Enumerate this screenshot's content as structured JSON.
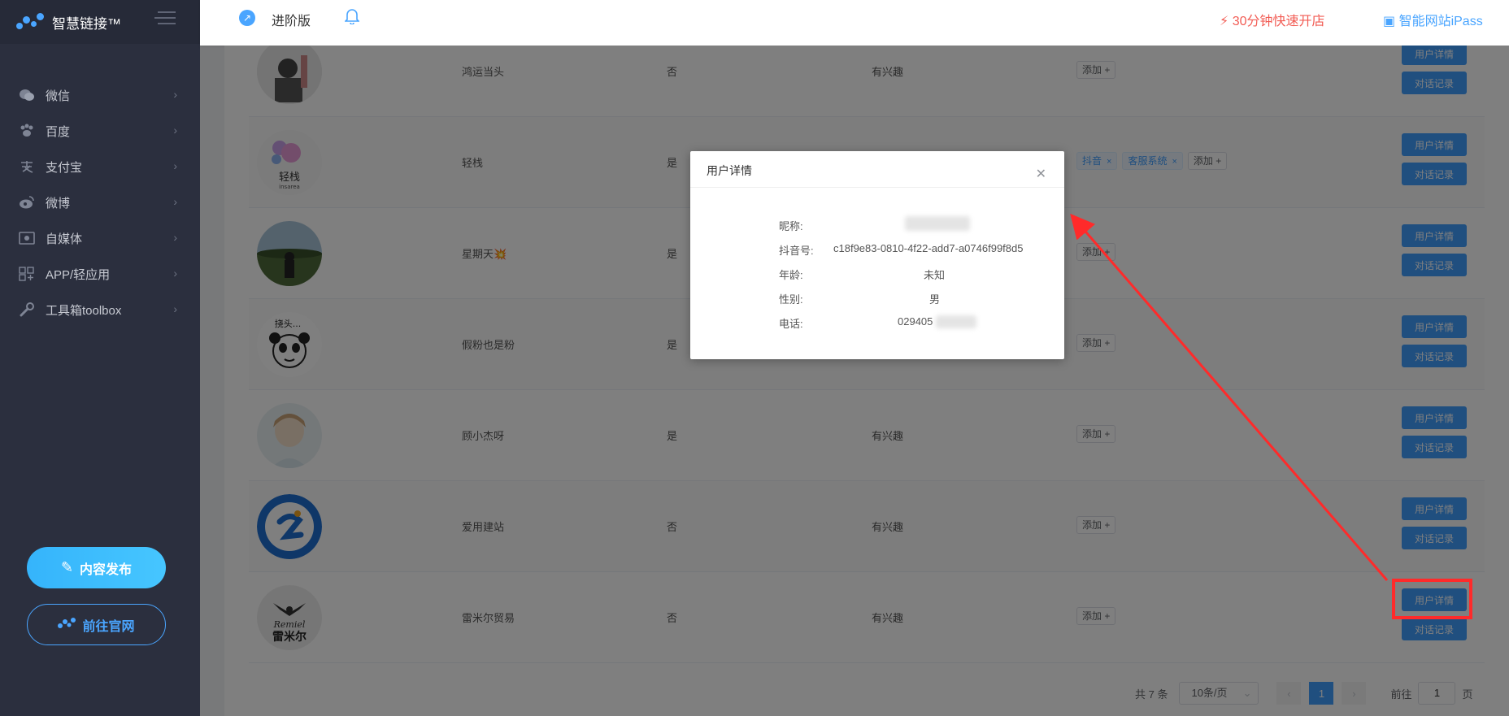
{
  "sidebar": {
    "brand": "智慧链接™",
    "items": [
      {
        "label": "微信",
        "icon": "wechat-icon"
      },
      {
        "label": "百度",
        "icon": "paw-icon"
      },
      {
        "label": "支付宝",
        "icon": "alipay-icon"
      },
      {
        "label": "微博",
        "icon": "weibo-icon"
      },
      {
        "label": "自媒体",
        "icon": "media-icon"
      },
      {
        "label": "APP/轻应用",
        "icon": "apps-icon"
      },
      {
        "label": "工具箱toolbox",
        "icon": "wrench-icon"
      }
    ],
    "publish_label": "内容发布",
    "site_label": "前往官网"
  },
  "header": {
    "edition": "进阶版",
    "quick_open": "30分钟快速开店",
    "ipass": "智能网站iPass"
  },
  "table": {
    "add_label": "添加 +",
    "detail_label": "用户详情",
    "chat_label": "对话记录",
    "rows": [
      {
        "name": "鸿运当头",
        "follow": "否",
        "interest": "有兴趣",
        "tags": []
      },
      {
        "name": "轻栈",
        "follow": "是",
        "interest": "",
        "tags": [
          "抖音",
          "客服系统"
        ]
      },
      {
        "name": "星期天💥",
        "follow": "是",
        "interest": "",
        "tags": []
      },
      {
        "name": "假粉也是粉",
        "follow": "是",
        "interest": "",
        "tags": []
      },
      {
        "name": "顾小杰呀",
        "follow": "是",
        "interest": "有兴趣",
        "tags": []
      },
      {
        "name": "爱用建站",
        "follow": "否",
        "interest": "有兴趣",
        "tags": []
      },
      {
        "name": "雷米尔贸易",
        "follow": "否",
        "interest": "有兴趣",
        "tags": []
      }
    ],
    "avatar_text": {
      "qingzhan": "轻栈",
      "qingzhan_sub": "insarea",
      "raotou": "挠头...",
      "remiel_script": "Remiel",
      "remiel_cn": "雷米尔"
    }
  },
  "pager": {
    "total": "共 7 条",
    "page_size": "10条/页",
    "current": "1",
    "goto_prefix": "前往",
    "goto_value": "1",
    "goto_suffix": "页"
  },
  "modal": {
    "title": "用户详情",
    "nickname_label": "昵称:",
    "douyin_label": "抖音号:",
    "douyin_value": "c18f9e83-0810-4f22-add7-a0746f99f8d5",
    "age_label": "年龄:",
    "age_value": "未知",
    "gender_label": "性别:",
    "gender_value": "男",
    "phone_label": "电话:",
    "phone_value": "029405"
  },
  "colors": {
    "accent": "#409eff",
    "sidebar_bg": "#2b2f3e",
    "annotation_red": "#ff2a2a",
    "quick_open": "#f25c54"
  }
}
